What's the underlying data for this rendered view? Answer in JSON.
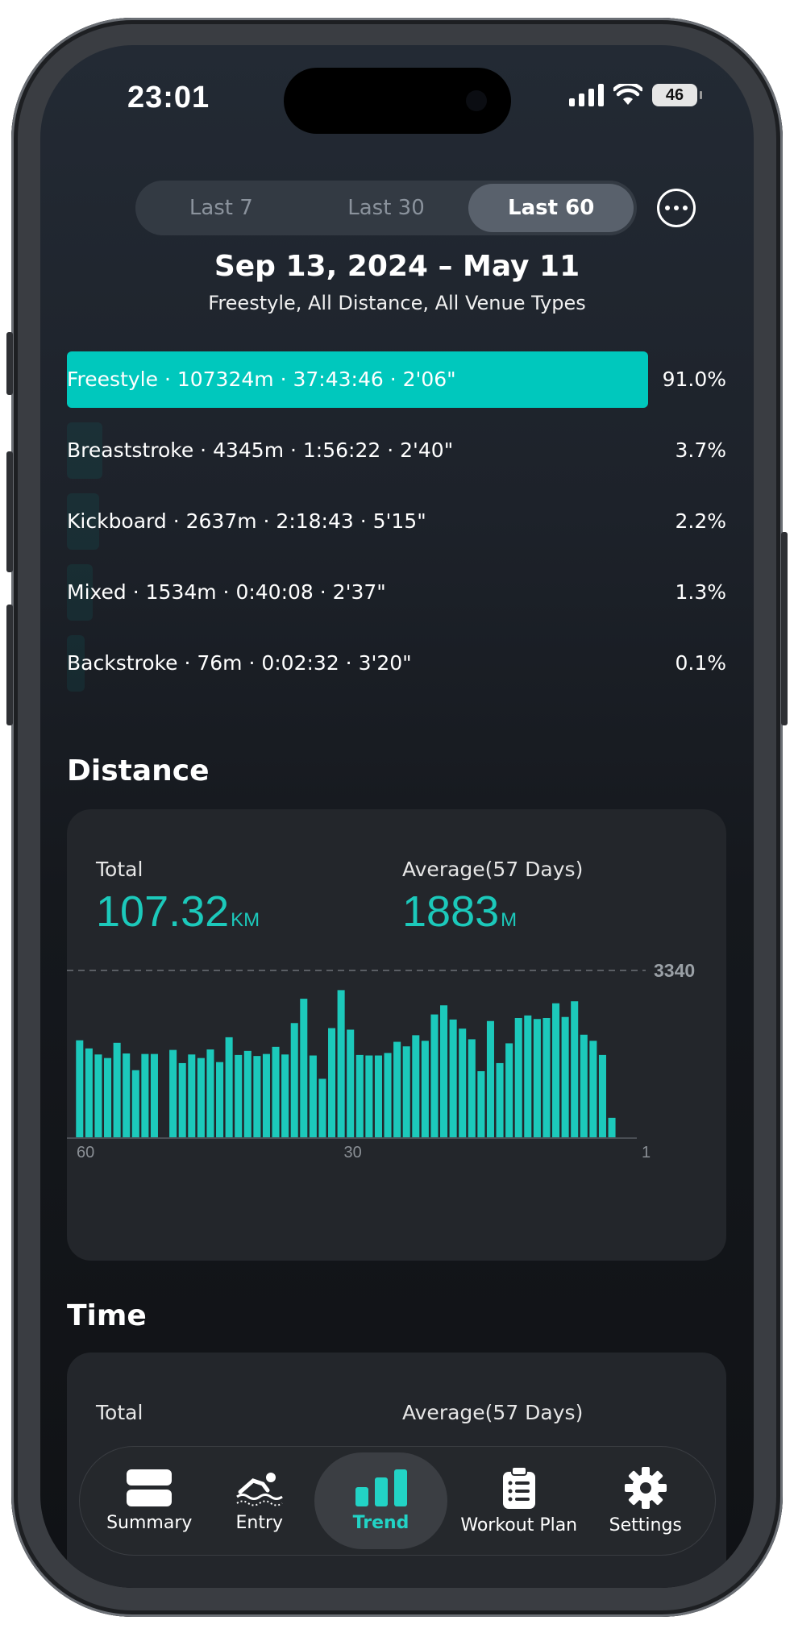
{
  "status": {
    "time": "23:01",
    "battery": "46"
  },
  "segments": [
    "Last 7",
    "Last 30",
    "Last 60"
  ],
  "active_segment": "Last 60",
  "range": {
    "title": "Sep 13, 2024 – May 11",
    "subtitle": "Freestyle, All Distance, All Venue Types"
  },
  "strokes": [
    {
      "label": "Freestyle · 107324m · 37:43:46 · 2'06\"",
      "pct": "91.0%",
      "share": 0.91
    },
    {
      "label": "Breaststroke · 4345m · 1:56:22 · 2'40\"",
      "pct": "3.7%",
      "share": 0.037
    },
    {
      "label": "Kickboard · 2637m · 2:18:43 · 5'15\"",
      "pct": "2.2%",
      "share": 0.022
    },
    {
      "label": "Mixed · 1534m · 0:40:08 · 2'37\"",
      "pct": "1.3%",
      "share": 0.013
    },
    {
      "label": "Backstroke · 76m · 0:02:32 · 3'20\"",
      "pct": "0.1%",
      "share": 0.001
    }
  ],
  "distance": {
    "heading": "Distance",
    "total_label": "Total",
    "total_value": "107.32",
    "total_unit": "KM",
    "avg_label": "Average(57 Days)",
    "avg_value": "1883",
    "avg_unit": "M"
  },
  "time_section": {
    "heading": "Time",
    "total_label": "Total",
    "avg_label": "Average(57 Days)"
  },
  "tabs": [
    "Summary",
    "Entry",
    "Trend",
    "Workout Plan",
    "Settings"
  ],
  "active_tab": "Trend",
  "colors": {
    "accent": "#00c8bd",
    "background": "#1b1f25",
    "card": "#23262b"
  },
  "chart_data": {
    "type": "bar",
    "x": [
      60,
      59,
      58,
      57,
      56,
      55,
      54,
      53,
      52,
      51,
      50,
      49,
      48,
      47,
      46,
      45,
      44,
      43,
      42,
      41,
      40,
      39,
      38,
      37,
      36,
      35,
      34,
      33,
      32,
      31,
      30,
      29,
      28,
      27,
      26,
      25,
      24,
      23,
      22,
      21,
      20,
      19,
      18,
      17,
      16,
      15,
      14,
      13,
      12,
      11,
      10,
      9,
      8,
      7,
      6,
      5,
      4,
      3,
      2,
      1
    ],
    "values": [
      1930,
      1770,
      1650,
      1580,
      1880,
      1670,
      1340,
      1660,
      1660,
      0,
      1740,
      1480,
      1650,
      1580,
      1750,
      1500,
      1990,
      1640,
      1720,
      1620,
      1660,
      1800,
      1650,
      2270,
      2750,
      1630,
      1170,
      2170,
      2920,
      2140,
      1640,
      1630,
      1630,
      1680,
      1900,
      1810,
      2030,
      1920,
      2440,
      2620,
      2340,
      2160,
      1950,
      1320,
      2310,
      1480,
      1870,
      2370,
      2420,
      2350,
      2370,
      2660,
      2390,
      2700,
      2040,
      1920,
      1640,
      400,
      0,
      0
    ],
    "reference_line": 3340,
    "reference_label": "3340",
    "x_tick_labels": [
      "60",
      "30",
      "1"
    ],
    "ylim": [
      0,
      3340
    ],
    "grid": false
  }
}
